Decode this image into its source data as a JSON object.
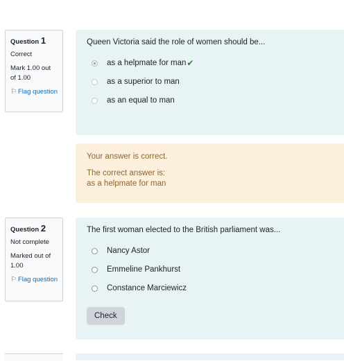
{
  "questions": [
    {
      "label": "Question",
      "number": "1",
      "state": "Correct",
      "mark": "Mark 1.00 out of 1.00",
      "flag_label": "Flag question",
      "text": "Queen Victoria said the role of women should be...",
      "options": [
        {
          "label": "as a helpmate for man",
          "selected": true,
          "correct": true
        },
        {
          "label": "as a superior to man",
          "selected": false
        },
        {
          "label": "as an equal to man",
          "selected": false
        }
      ],
      "feedback": {
        "result": "Your answer is correct.",
        "correct_intro": "The correct answer is:",
        "correct_answer": "as a helpmate for man"
      }
    },
    {
      "label": "Question",
      "number": "2",
      "state": "Not complete",
      "mark": "Marked out of 1.00",
      "flag_label": "Flag question",
      "text": "The first woman elected to the British parliament was...",
      "options": [
        {
          "label": "Nancy Astor"
        },
        {
          "label": "Emmeline Pankhurst"
        },
        {
          "label": "Constance Marciewicz"
        }
      ],
      "check_label": "Check"
    }
  ],
  "colors": {
    "formulation_bg": "#e7f3f5",
    "feedback_bg": "#fcefdc",
    "feedback_text": "#8e662e",
    "link": "#0f6cbf",
    "correct_check": "#357a32"
  },
  "icons": {
    "flag": "flag-icon",
    "correct": "check-icon"
  }
}
